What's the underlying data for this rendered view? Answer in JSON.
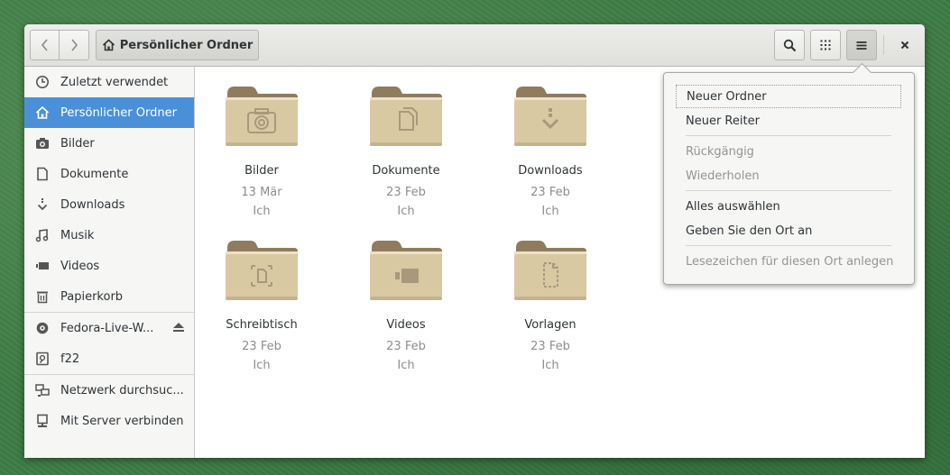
{
  "header": {
    "path_label": "Persönlicher Ordner"
  },
  "sidebar": {
    "items": [
      {
        "label": "Zuletzt verwendet",
        "icon": "clock-icon"
      },
      {
        "label": "Persönlicher Ordner",
        "icon": "home-icon",
        "active": true
      },
      {
        "label": "Bilder",
        "icon": "camera-icon"
      },
      {
        "label": "Dokumente",
        "icon": "document-icon"
      },
      {
        "label": "Downloads",
        "icon": "download-icon"
      },
      {
        "label": "Musik",
        "icon": "music-icon"
      },
      {
        "label": "Videos",
        "icon": "video-icon"
      },
      {
        "label": "Papierkorb",
        "icon": "trash-icon"
      },
      {
        "label": "Fedora-Live-W...",
        "icon": "disc-icon"
      },
      {
        "label": "f22",
        "icon": "drive-icon"
      },
      {
        "label": "Netzwerk durchsuc...",
        "icon": "network-icon"
      },
      {
        "label": "Mit Server verbinden",
        "icon": "server-icon"
      }
    ]
  },
  "files": [
    {
      "name": "Bilder",
      "date": "13 Mär",
      "owner": "Ich",
      "emblem": "camera-emblem"
    },
    {
      "name": "Dokumente",
      "date": "23 Feb",
      "owner": "Ich",
      "emblem": "documents-emblem"
    },
    {
      "name": "Downloads",
      "date": "23 Feb",
      "owner": "Ich",
      "emblem": "download-emblem"
    },
    {
      "name": "Schreibtisch",
      "date": "23 Feb",
      "owner": "Ich",
      "emblem": "desktop-emblem"
    },
    {
      "name": "Videos",
      "date": "23 Feb",
      "owner": "Ich",
      "emblem": "video-emblem"
    },
    {
      "name": "Vorlagen",
      "date": "23 Feb",
      "owner": "Ich",
      "emblem": "template-emblem"
    }
  ],
  "menu": {
    "items": [
      {
        "label": "Neuer Ordner",
        "enabled": true
      },
      {
        "label": "Neuer Reiter",
        "enabled": true
      },
      {
        "label": "Rückgängig",
        "enabled": false
      },
      {
        "label": "Wiederholen",
        "enabled": false
      },
      {
        "label": "Alles auswählen",
        "enabled": true
      },
      {
        "label": "Geben Sie den Ort an",
        "enabled": true
      },
      {
        "label": "Lesezeichen für diesen Ort anlegen",
        "enabled": false
      }
    ]
  },
  "colors": {
    "accent": "#4a90d9",
    "folder": "#d9c9a3",
    "folder_tab": "#8f7c5e",
    "background": "#3e7d46"
  }
}
